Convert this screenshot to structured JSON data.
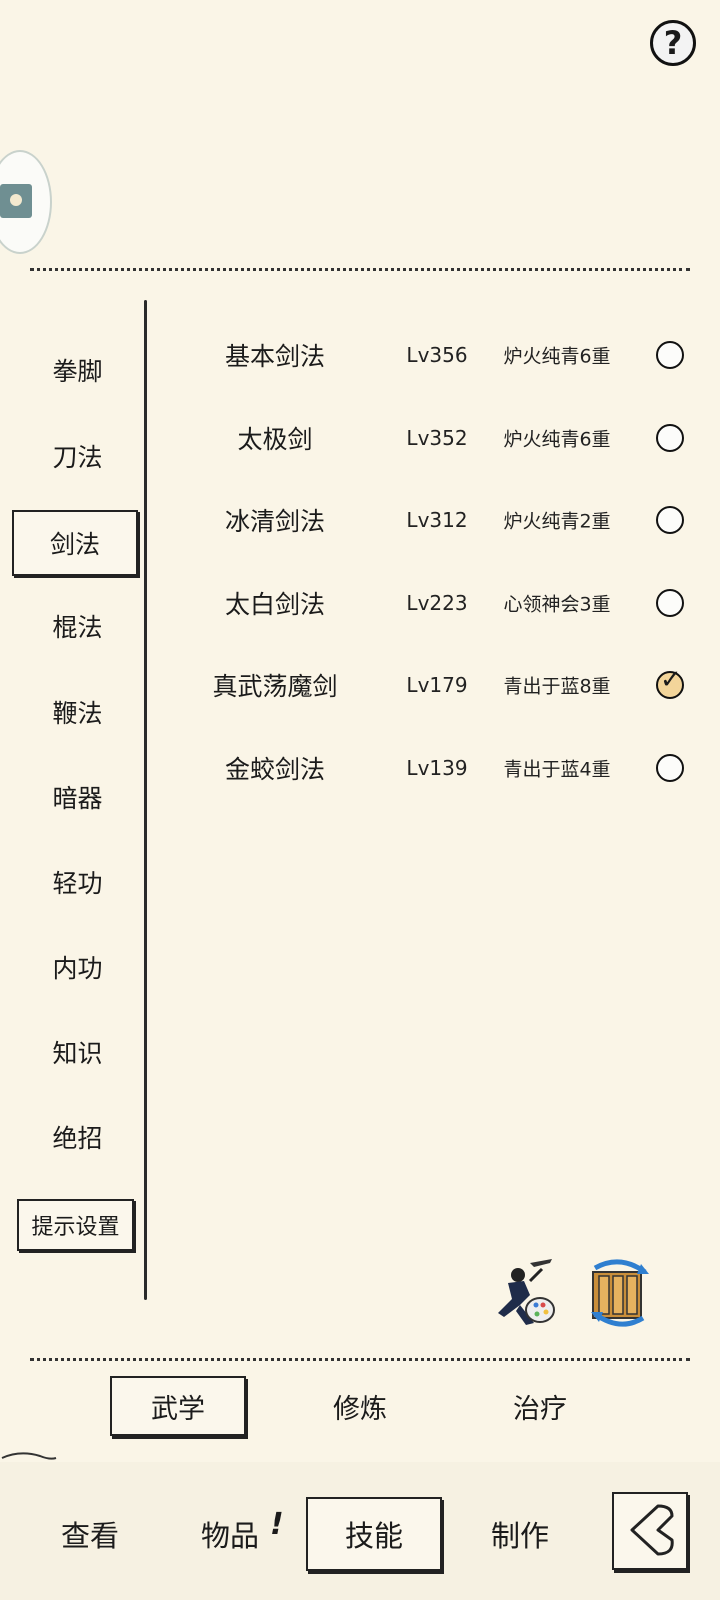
{
  "help": {
    "label": "?"
  },
  "categories": [
    "拳脚",
    "刀法",
    "剑法",
    "棍法",
    "鞭法",
    "暗器",
    "轻功",
    "内功",
    "知识",
    "绝招"
  ],
  "active_category": "剑法",
  "tips_button": "提示设置",
  "skills": [
    {
      "name": "基本剑法",
      "level": "Lv356",
      "realm": "炉火纯青6重",
      "checked": false
    },
    {
      "name": "太极剑",
      "level": "Lv352",
      "realm": "炉火纯青6重",
      "checked": false
    },
    {
      "name": "冰清剑法",
      "level": "Lv312",
      "realm": "炉火纯青2重",
      "checked": false
    },
    {
      "name": "太白剑法",
      "level": "Lv223",
      "realm": "心领神会3重",
      "checked": false
    },
    {
      "name": "真武荡魔剑",
      "level": "Lv179",
      "realm": "青出于蓝8重",
      "checked": true
    },
    {
      "name": "金蛟剑法",
      "level": "Lv139",
      "realm": "青出于蓝4重",
      "checked": false
    }
  ],
  "sub_tabs": [
    "武学",
    "修炼",
    "治疗"
  ],
  "active_sub_tab": "武学",
  "bottom_nav": [
    "查看",
    "物品",
    "技能",
    "制作"
  ],
  "active_bottom": "技能",
  "bottom_alert": "!"
}
